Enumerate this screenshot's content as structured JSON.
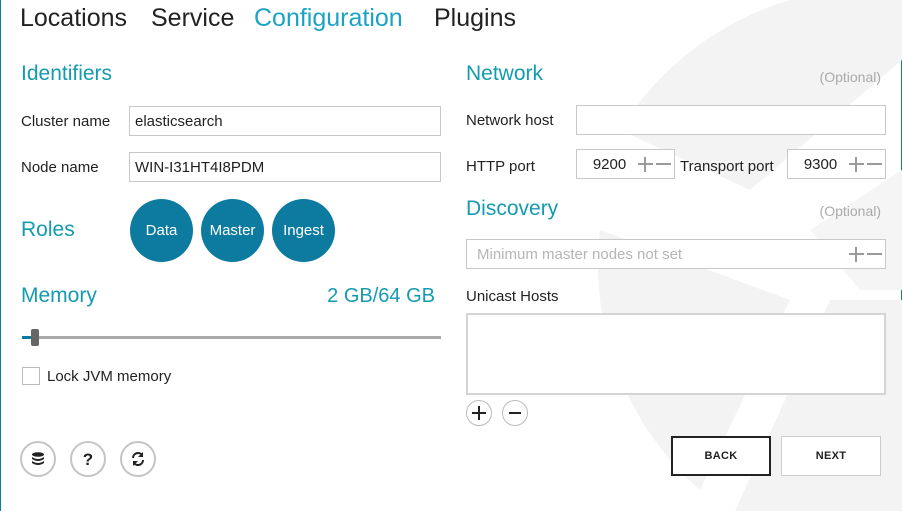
{
  "tabs": [
    {
      "label": "Locations",
      "active": false
    },
    {
      "label": "Service",
      "active": false
    },
    {
      "label": "Configuration",
      "active": true
    },
    {
      "label": "Plugins",
      "active": false
    }
  ],
  "identifiers": {
    "title": "Identifiers",
    "cluster_name_label": "Cluster name",
    "cluster_name_value": "elasticsearch",
    "node_name_label": "Node name",
    "node_name_value": "WIN-I31HT4I8PDM"
  },
  "roles": {
    "title": "Roles",
    "items": [
      "Data",
      "Master",
      "Ingest"
    ]
  },
  "memory": {
    "title": "Memory",
    "value_text": "2 GB/64 GB",
    "slider_fraction": 0.0313,
    "lock_label": "Lock JVM memory",
    "lock_checked": false
  },
  "network": {
    "title": "Network",
    "optional": "(Optional)",
    "host_label": "Network host",
    "host_value": "",
    "http_port_label": "HTTP port",
    "http_port_value": "9200",
    "transport_port_label": "Transport port",
    "transport_port_value": "9300"
  },
  "discovery": {
    "title": "Discovery",
    "optional": "(Optional)",
    "min_master_placeholder": "Minimum master nodes not set",
    "unicast_label": "Unicast Hosts",
    "unicast_value": ""
  },
  "buttons": {
    "back": "BACK",
    "next": "NEXT"
  },
  "icons": {
    "bottom_left": [
      "database-icon",
      "help-icon",
      "refresh-icon"
    ],
    "unicast": [
      "add-icon",
      "remove-icon"
    ]
  },
  "colors": {
    "accent": "#149bb0",
    "active_tab": "#1aa3c4",
    "role_bubble": "#0d7aa0",
    "frame_border": "#0e7ea0"
  }
}
